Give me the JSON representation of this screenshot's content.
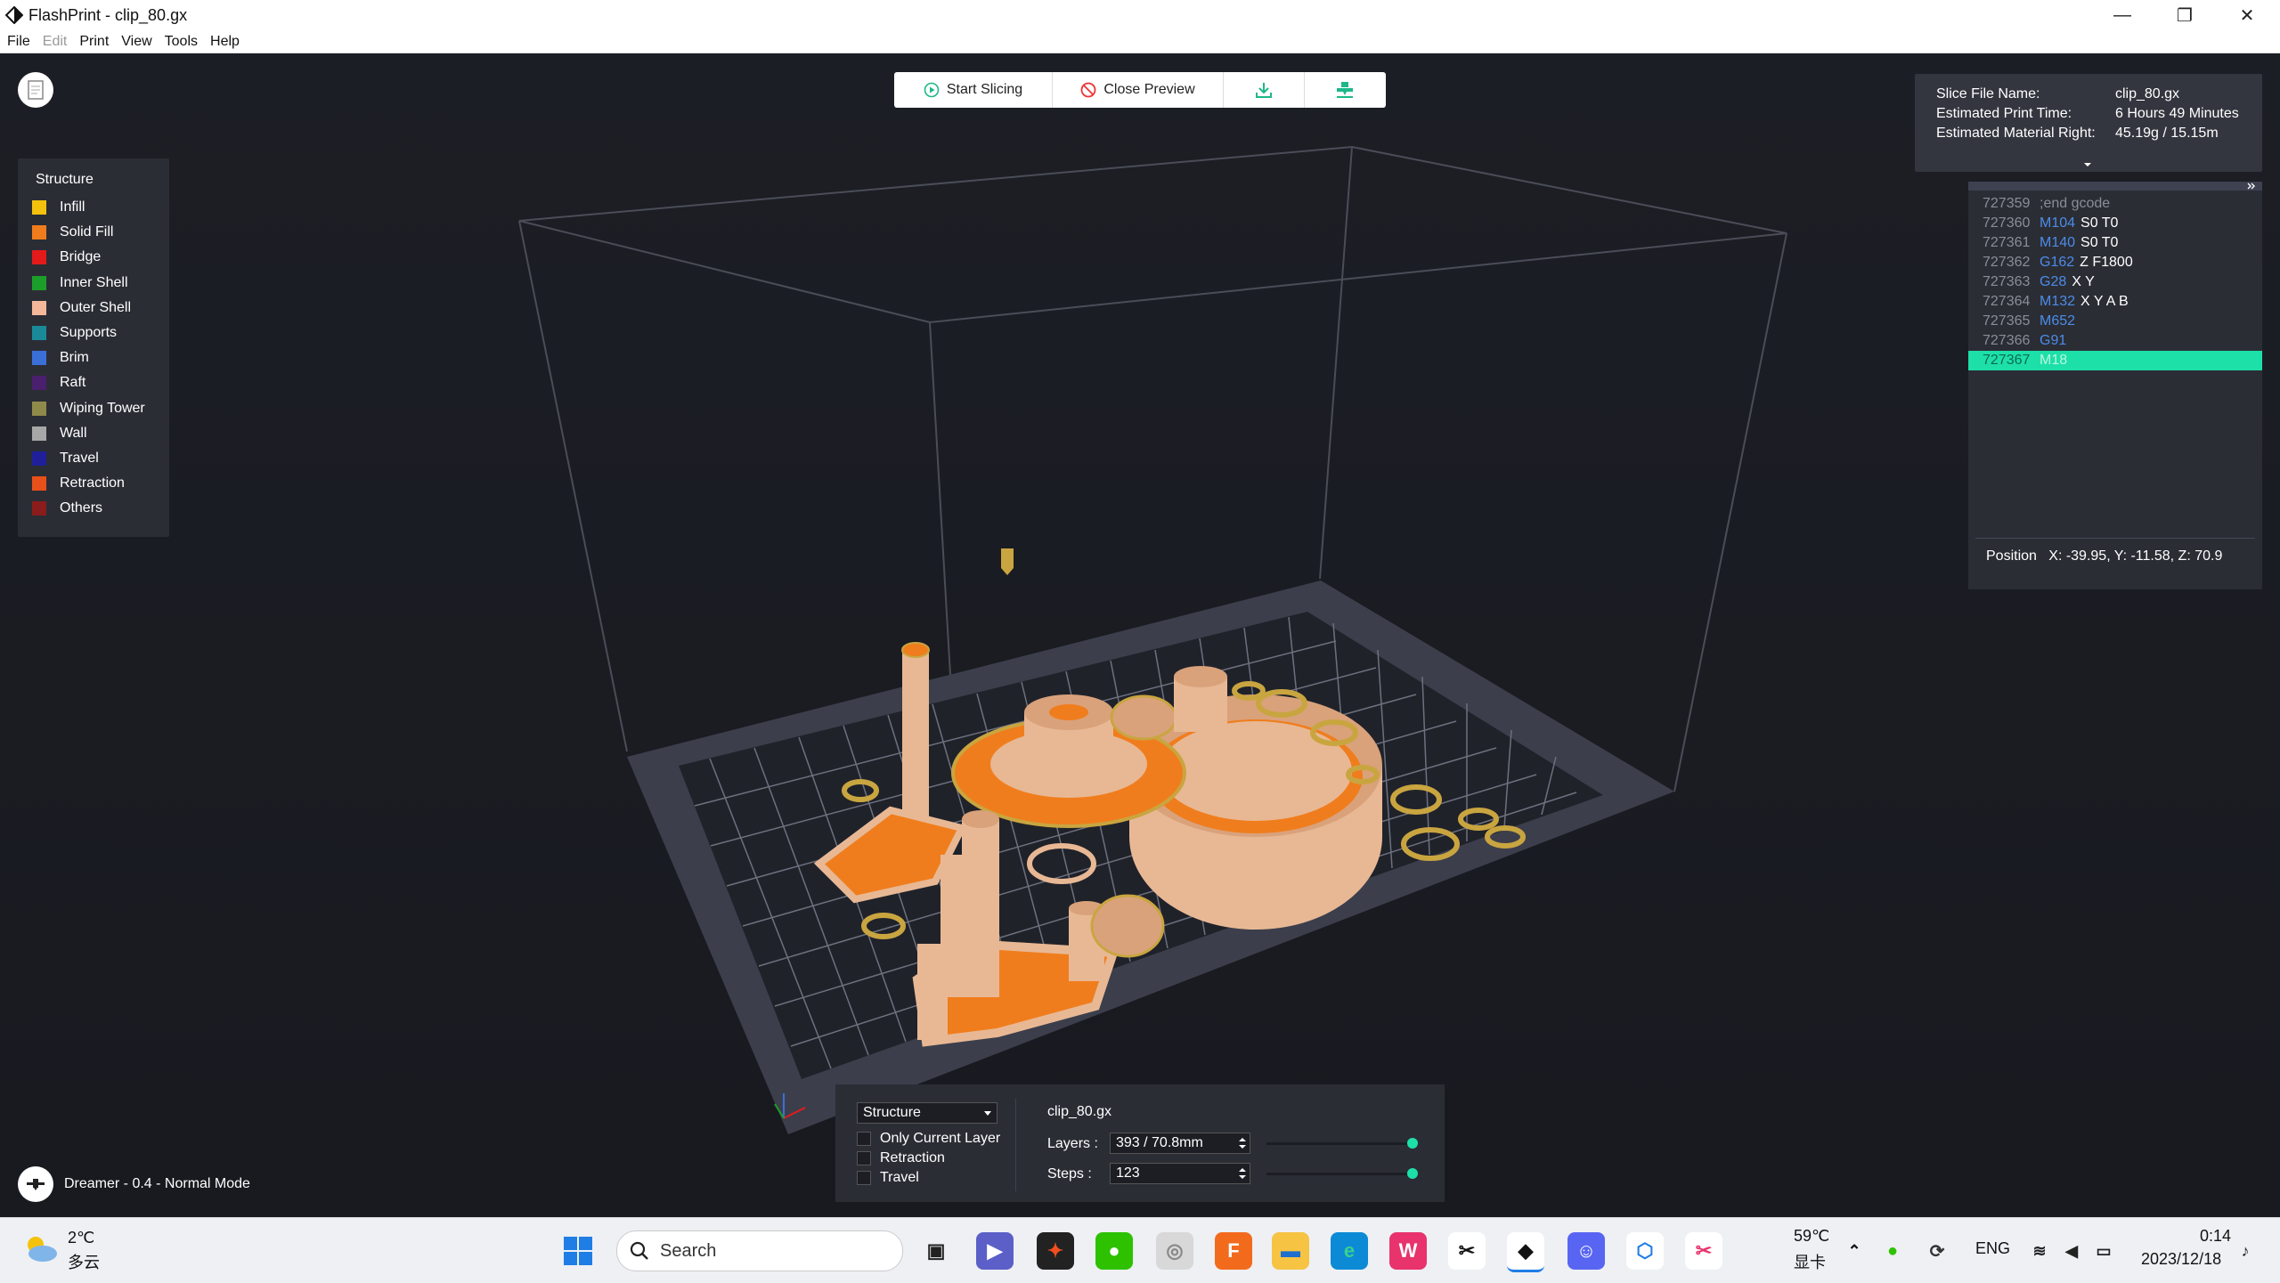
{
  "window": {
    "title": "FlashPrint - clip_80.gx",
    "controls": {
      "minimize": "—",
      "maximize": "❐",
      "close": "✕"
    }
  },
  "menu": [
    "File",
    "Edit",
    "Print",
    "View",
    "Tools",
    "Help"
  ],
  "toolbar": {
    "start_slicing": "Start Slicing",
    "close_preview": "Close Preview"
  },
  "legend": {
    "title": "Structure",
    "items": [
      {
        "label": "Infill",
        "color": "#f4c20d"
      },
      {
        "label": "Solid Fill",
        "color": "#f07d1d"
      },
      {
        "label": "Bridge",
        "color": "#e31a1a"
      },
      {
        "label": "Inner Shell",
        "color": "#1c9e2a"
      },
      {
        "label": "Outer Shell",
        "color": "#f4b79a"
      },
      {
        "label": "Supports",
        "color": "#1a8a99"
      },
      {
        "label": "Brim",
        "color": "#3b6fd8"
      },
      {
        "label": "Raft",
        "color": "#4a1f6e"
      },
      {
        "label": "Wiping Tower",
        "color": "#8f8a4a"
      },
      {
        "label": "Wall",
        "color": "#a7a7a7"
      },
      {
        "label": "Travel",
        "color": "#1f2099"
      },
      {
        "label": "Retraction",
        "color": "#e8501a"
      },
      {
        "label": "Others",
        "color": "#8b1c1c"
      }
    ]
  },
  "slice_info": {
    "file_name_label": "Slice File Name:",
    "file_name": "clip_80.gx",
    "print_time_label": "Estimated Print Time:",
    "print_time": "6 Hours 49 Minutes",
    "material_label": "Estimated Material Right:",
    "material": "45.19g / 15.15m"
  },
  "gcode": {
    "lines": [
      {
        "num": "727359",
        "cmd": "",
        "args": "",
        "comment": ";end gcode"
      },
      {
        "num": "727360",
        "cmd": "M104",
        "args": "S0 T0",
        "comment": ""
      },
      {
        "num": "727361",
        "cmd": "M140",
        "args": "S0 T0",
        "comment": ""
      },
      {
        "num": "727362",
        "cmd": "G162",
        "args": "Z F1800",
        "comment": ""
      },
      {
        "num": "727363",
        "cmd": "G28",
        "args": "X Y",
        "comment": ""
      },
      {
        "num": "727364",
        "cmd": "M132",
        "args": "X Y A B",
        "comment": ""
      },
      {
        "num": "727365",
        "cmd": "M652",
        "args": "",
        "comment": ""
      },
      {
        "num": "727366",
        "cmd": "G91",
        "args": "",
        "comment": ""
      },
      {
        "num": "727367",
        "cmd": "M18",
        "args": "",
        "comment": ""
      }
    ],
    "highlight_index": 8,
    "position_label": "Position",
    "position_value": "X: -39.95, Y: -11.58, Z: 70.9"
  },
  "bottom_panel": {
    "mode_select": "Structure",
    "options": [
      "Only Current Layer",
      "Retraction",
      "Travel"
    ],
    "file_name": "clip_80.gx",
    "layers_label": "Layers :",
    "layers_value": "393 / 70.8mm",
    "steps_label": "Steps :",
    "steps_value": "123",
    "layers_progress": 1.0,
    "steps_progress": 1.0
  },
  "status": {
    "printer": "Dreamer - 0.4 - Normal Mode"
  },
  "taskbar": {
    "weather_temp": "2℃",
    "weather_desc": "多云",
    "search_placeholder": "Search",
    "cpu_temp": "59℃",
    "cpu_label": "显卡",
    "language": "ENG",
    "time": "0:14",
    "date": "2023/12/18",
    "pinned_icons": [
      "windows-start-icon",
      "task-view-icon",
      "meet-icon",
      "figma-icon",
      "wechat-icon",
      "app-icon",
      "fusion360-icon",
      "file-explorer-icon",
      "edge-icon",
      "wps-icon",
      "capcut-icon",
      "flashprint-icon",
      "discord-icon",
      "vpn-icon",
      "snipping-tool-icon"
    ],
    "accent": "#1de0a8"
  }
}
